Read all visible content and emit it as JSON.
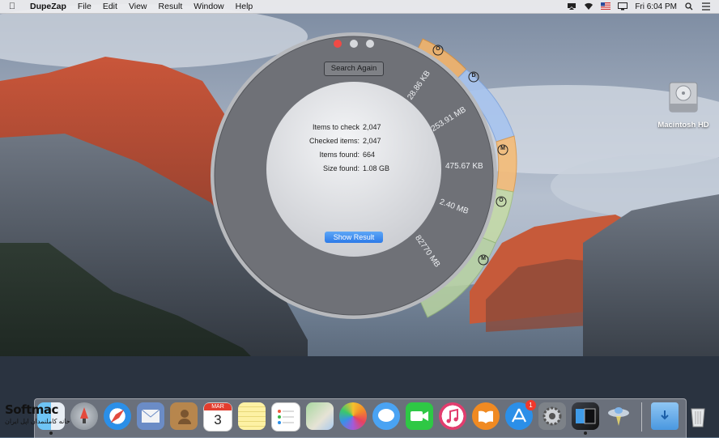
{
  "menubar": {
    "app_name": "DupeZap",
    "menus": [
      "File",
      "Edit",
      "View",
      "Result",
      "Window",
      "Help"
    ],
    "clock": "Fri 6:04 PM"
  },
  "window": {
    "search_again_label": "Search Again",
    "show_result_label": "Show Result",
    "stats": [
      {
        "label": "Items to check",
        "value": "2,047"
      },
      {
        "label": "Checked items:",
        "value": "2,047"
      },
      {
        "label": "Items found:",
        "value": "664"
      },
      {
        "label": "Size found:",
        "value": "1.08 GB"
      }
    ],
    "segments": [
      {
        "size": "28.86 KB",
        "letter": "O",
        "color": "#f2b36a"
      },
      {
        "size": "253.91 MB",
        "letter": "D",
        "color": "#a7c4ef"
      },
      {
        "size": "475.67 KB",
        "letter": "M",
        "color": "#f5bc78"
      },
      {
        "size": "2.40 MB",
        "letter": "O",
        "color": "#c6dca6"
      },
      {
        "size": "82770 MB",
        "letter": "M",
        "color": "#b9d4a2"
      }
    ]
  },
  "desktop": {
    "hd_label": "Macintosh HD"
  },
  "dock": {
    "calendar_month": "MAR",
    "calendar_day": "3",
    "app_store_badge": "1",
    "items": [
      "finder-icon",
      "launchpad-icon",
      "safari-icon",
      "mail-icon",
      "contacts-icon",
      "calendar-icon",
      "notes-icon",
      "reminders-icon",
      "maps-icon",
      "photos-icon",
      "messages-icon",
      "facetime-icon",
      "itunes-icon",
      "ibooks-icon",
      "app-store-icon",
      "system-preferences-icon",
      "dupezap-icon",
      "ufo-icon",
      "downloads-folder-icon",
      "trash-icon"
    ]
  },
  "watermark": {
    "title": "Softmac",
    "subtitle": "خانه کاملنمدان اپل ایران"
  }
}
